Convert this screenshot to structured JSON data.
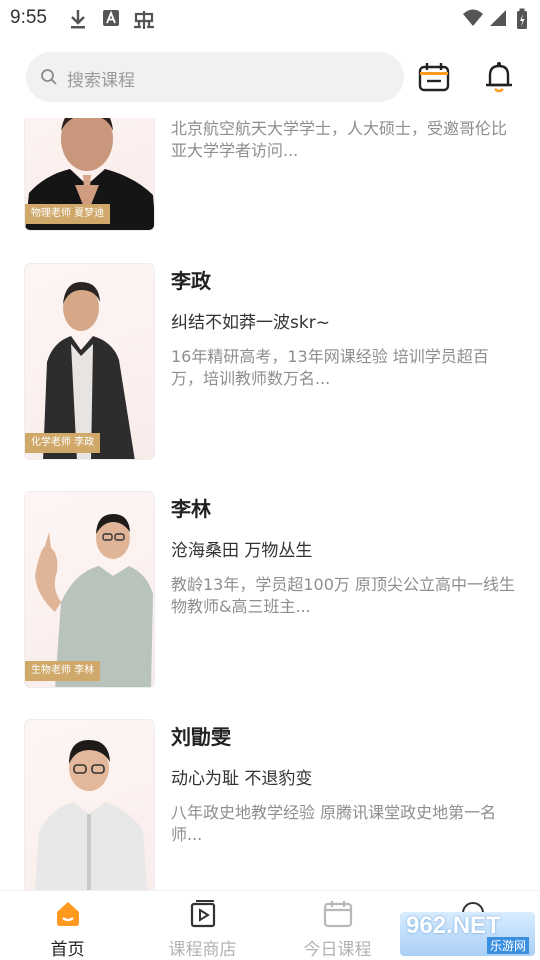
{
  "statusbar": {
    "time": "9:55"
  },
  "search": {
    "placeholder": "搜索课程"
  },
  "teachers": [
    {
      "tag": "物理老师 夏梦迪",
      "name": "",
      "motto": "",
      "desc": "北京航空航天大学学士，人大硕士，受邀哥伦比亚大学学者访问..."
    },
    {
      "tag": "化学老师 李政",
      "name": "李政",
      "motto": "纠结不如莽一波skr~",
      "desc": "16年精研高考，13年网课经验 培训学员超百万，培训教师数万名..."
    },
    {
      "tag": "生物老师 李林",
      "name": "李林",
      "motto": "沧海桑田 万物丛生",
      "desc": "教龄13年，学员超100万 原顶尖公立高中一线生物教师&高三班主..."
    },
    {
      "tag": "",
      "name": "刘勖雯",
      "motto": "动心为耻 不退豹变",
      "desc": "八年政史地教学经验 原腾讯课堂政史地第一名师..."
    }
  ],
  "nav": {
    "tabs": [
      {
        "label": "首页",
        "icon": "home-icon",
        "active": true
      },
      {
        "label": "课程商店",
        "icon": "play-square-icon",
        "active": false
      },
      {
        "label": "今日课程",
        "icon": "calendar-icon",
        "active": false
      },
      {
        "label": "",
        "icon": "chat-icon",
        "active": false
      }
    ]
  },
  "watermark": {
    "main": "962.NET",
    "sub": "乐游网"
  },
  "colors": {
    "accent": "#ff9a1f",
    "tag": "#cfa86a",
    "text_muted": "#8e8e8e"
  }
}
